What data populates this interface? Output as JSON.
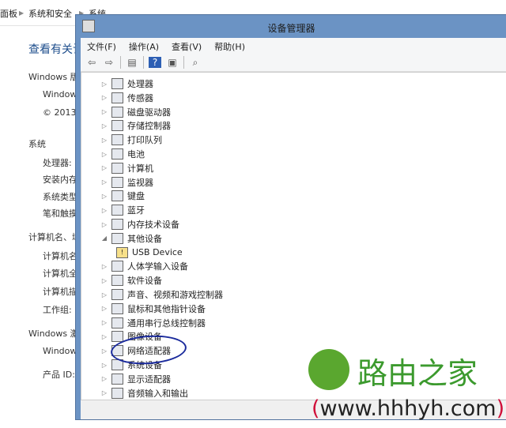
{
  "breadcrumb": [
    "面板",
    "系统和安全",
    "系统"
  ],
  "background": {
    "heading": "查看有关计",
    "lines": [
      "Windows 版",
      "Window",
      "© 2013",
      "系统",
      "处理器:",
      "安装内存",
      "系统类型",
      "笔和触摸",
      "计算机名、域",
      "计算机名",
      "计算机全",
      "计算机描",
      "工作组:",
      "Windows 激",
      "Window",
      "产品 ID:"
    ]
  },
  "window": {
    "title": "设备管理器",
    "menu": [
      "文件(F)",
      "操作(A)",
      "查看(V)",
      "帮助(H)"
    ],
    "toolbar_icons": [
      "back-icon",
      "forward-icon",
      "properties-icon",
      "help-icon",
      "update-icon",
      "scan-icon"
    ],
    "tree": [
      {
        "label": "处理器",
        "expanded": false
      },
      {
        "label": "传感器",
        "expanded": false
      },
      {
        "label": "磁盘驱动器",
        "expanded": false
      },
      {
        "label": "存储控制器",
        "expanded": false
      },
      {
        "label": "打印队列",
        "expanded": false
      },
      {
        "label": "电池",
        "expanded": false
      },
      {
        "label": "计算机",
        "expanded": false
      },
      {
        "label": "监视器",
        "expanded": false
      },
      {
        "label": "键盘",
        "expanded": false
      },
      {
        "label": "蓝牙",
        "expanded": false
      },
      {
        "label": "内存技术设备",
        "expanded": false
      },
      {
        "label": "其他设备",
        "expanded": true
      },
      {
        "label": "USB Device",
        "child": true
      },
      {
        "label": "人体学输入设备",
        "expanded": false
      },
      {
        "label": "软件设备",
        "expanded": false
      },
      {
        "label": "声音、视频和游戏控制器",
        "expanded": false
      },
      {
        "label": "鼠标和其他指针设备",
        "expanded": false
      },
      {
        "label": "通用串行总线控制器",
        "expanded": false
      },
      {
        "label": "图像设备",
        "expanded": false
      },
      {
        "label": "网络适配器",
        "expanded": false,
        "circled": true
      },
      {
        "label": "系统设备",
        "expanded": false
      },
      {
        "label": "显示适配器",
        "expanded": false
      },
      {
        "label": "音频输入和输出",
        "expanded": false
      }
    ]
  },
  "watermark": {
    "name": "路由之家",
    "url": "(www.hhhyh.com)",
    "color": "#3c9a2e"
  },
  "colors": {
    "titlebar": "#6b93c4",
    "annotation": "#1a2a9c"
  }
}
